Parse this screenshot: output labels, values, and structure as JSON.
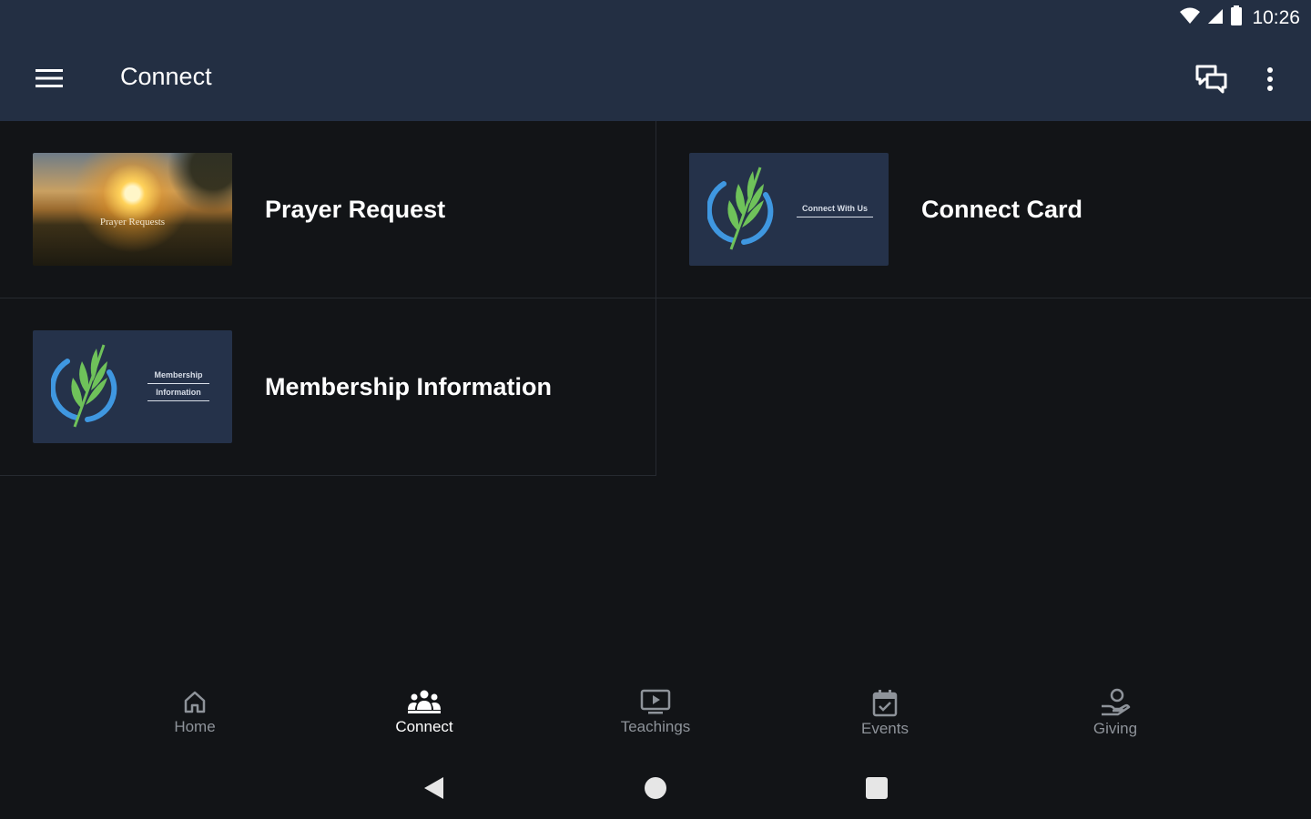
{
  "status_bar": {
    "time": "10:26",
    "icons": [
      "wifi-icon",
      "signal-icon",
      "battery-icon"
    ]
  },
  "app_bar": {
    "title": "Connect",
    "menu_icon": "hamburger-menu-icon",
    "actions": [
      "chat-icon",
      "more-vert-icon"
    ]
  },
  "tiles": [
    {
      "label": "Prayer Request",
      "thumbnail_caption": "Prayer Requests",
      "thumbnail": "sunset-photo"
    },
    {
      "label": "Connect Card",
      "thumbnail_caption": "Connect With Us",
      "thumbnail": "palm-leaf-logo"
    },
    {
      "label": "Membership Information",
      "thumbnail_caption_line1": "Membership",
      "thumbnail_caption_line2": "Information",
      "thumbnail": "palm-leaf-logo"
    }
  ],
  "bottom_nav": {
    "active": "Connect",
    "items": [
      {
        "label": "Home",
        "icon": "home-icon"
      },
      {
        "label": "Connect",
        "icon": "people-icon"
      },
      {
        "label": "Teachings",
        "icon": "play-screen-icon"
      },
      {
        "label": "Events",
        "icon": "calendar-check-icon"
      },
      {
        "label": "Giving",
        "icon": "giving-hand-icon"
      }
    ]
  },
  "system_nav": [
    "back-icon",
    "home-circle-icon",
    "recents-icon"
  ],
  "colors": {
    "app_bar": "#232f43",
    "background": "#121417",
    "logo_tile": "#25324a",
    "accent_blue": "#3f97e0",
    "leaf_green": "#6fc25a",
    "nav_inactive": "#8e939a"
  }
}
